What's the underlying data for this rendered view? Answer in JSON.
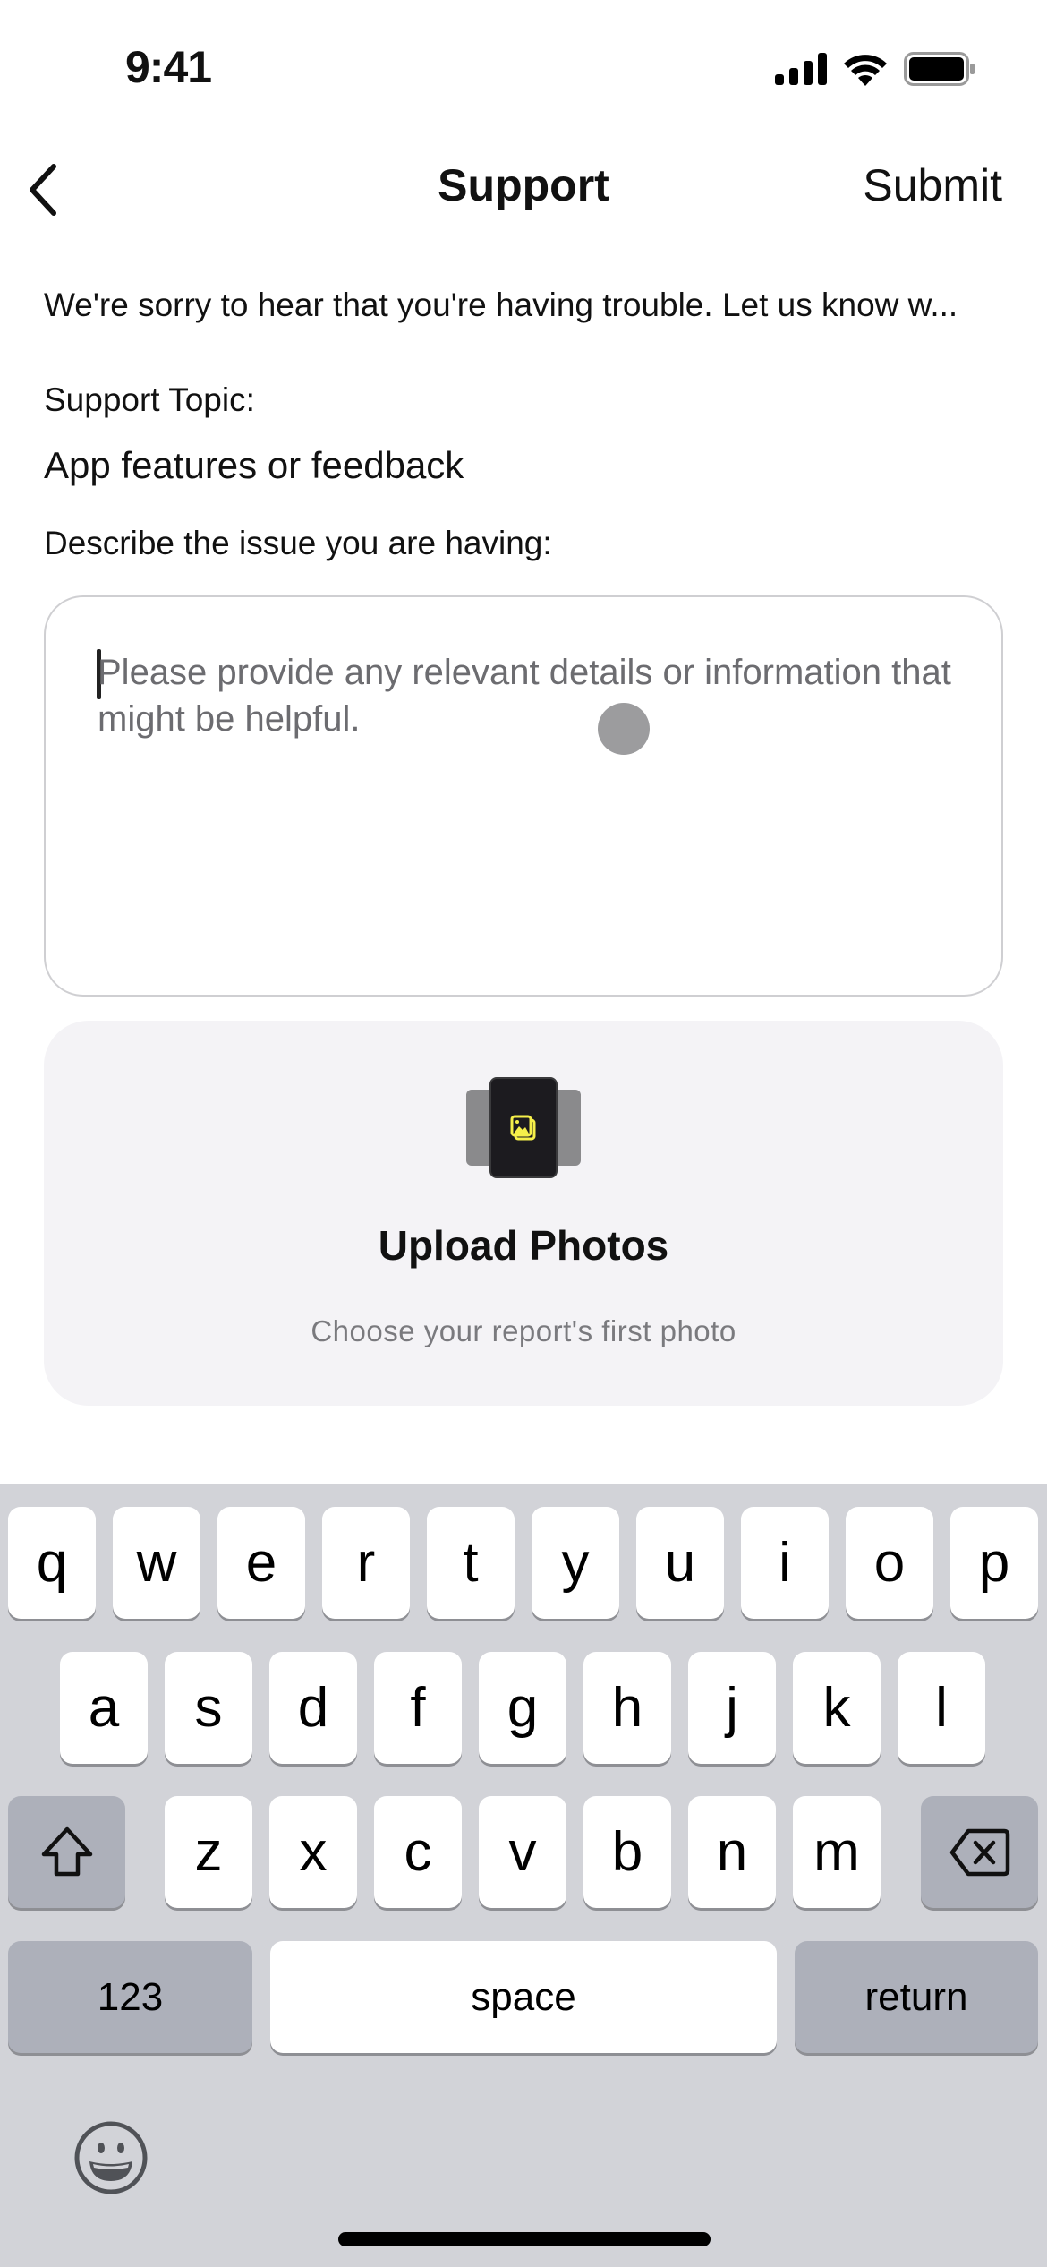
{
  "status_bar": {
    "time": "9:41",
    "icons": [
      "cellular-signal-icon",
      "wifi-icon",
      "battery-icon"
    ]
  },
  "nav": {
    "back_icon": "chevron-left-icon",
    "title": "Support",
    "submit_label": "Submit"
  },
  "form": {
    "intro_text": "We're sorry to hear that you're having trouble. Let us know w...",
    "topic_label": "Support Topic:",
    "topic_value": "App features or feedback",
    "describe_label": "Describe the issue you are having:",
    "description_value": "",
    "description_placeholder": "Please provide any relevant details or information that might be helpful."
  },
  "upload": {
    "icon": "photo-stack-icon",
    "title": "Upload Photos",
    "subtitle": "Choose your report's first photo",
    "accent_color": "#f5ef4a"
  },
  "keyboard": {
    "row1": [
      "q",
      "w",
      "e",
      "r",
      "t",
      "y",
      "u",
      "i",
      "o",
      "p"
    ],
    "row2": [
      "a",
      "s",
      "d",
      "f",
      "g",
      "h",
      "j",
      "k",
      "l"
    ],
    "row3": [
      "z",
      "x",
      "c",
      "v",
      "b",
      "n",
      "m"
    ],
    "shift_icon": "shift-icon",
    "delete_icon": "backspace-icon",
    "numbers_label": "123",
    "space_label": "space",
    "return_label": "return",
    "emoji_icon": "emoji-icon"
  }
}
